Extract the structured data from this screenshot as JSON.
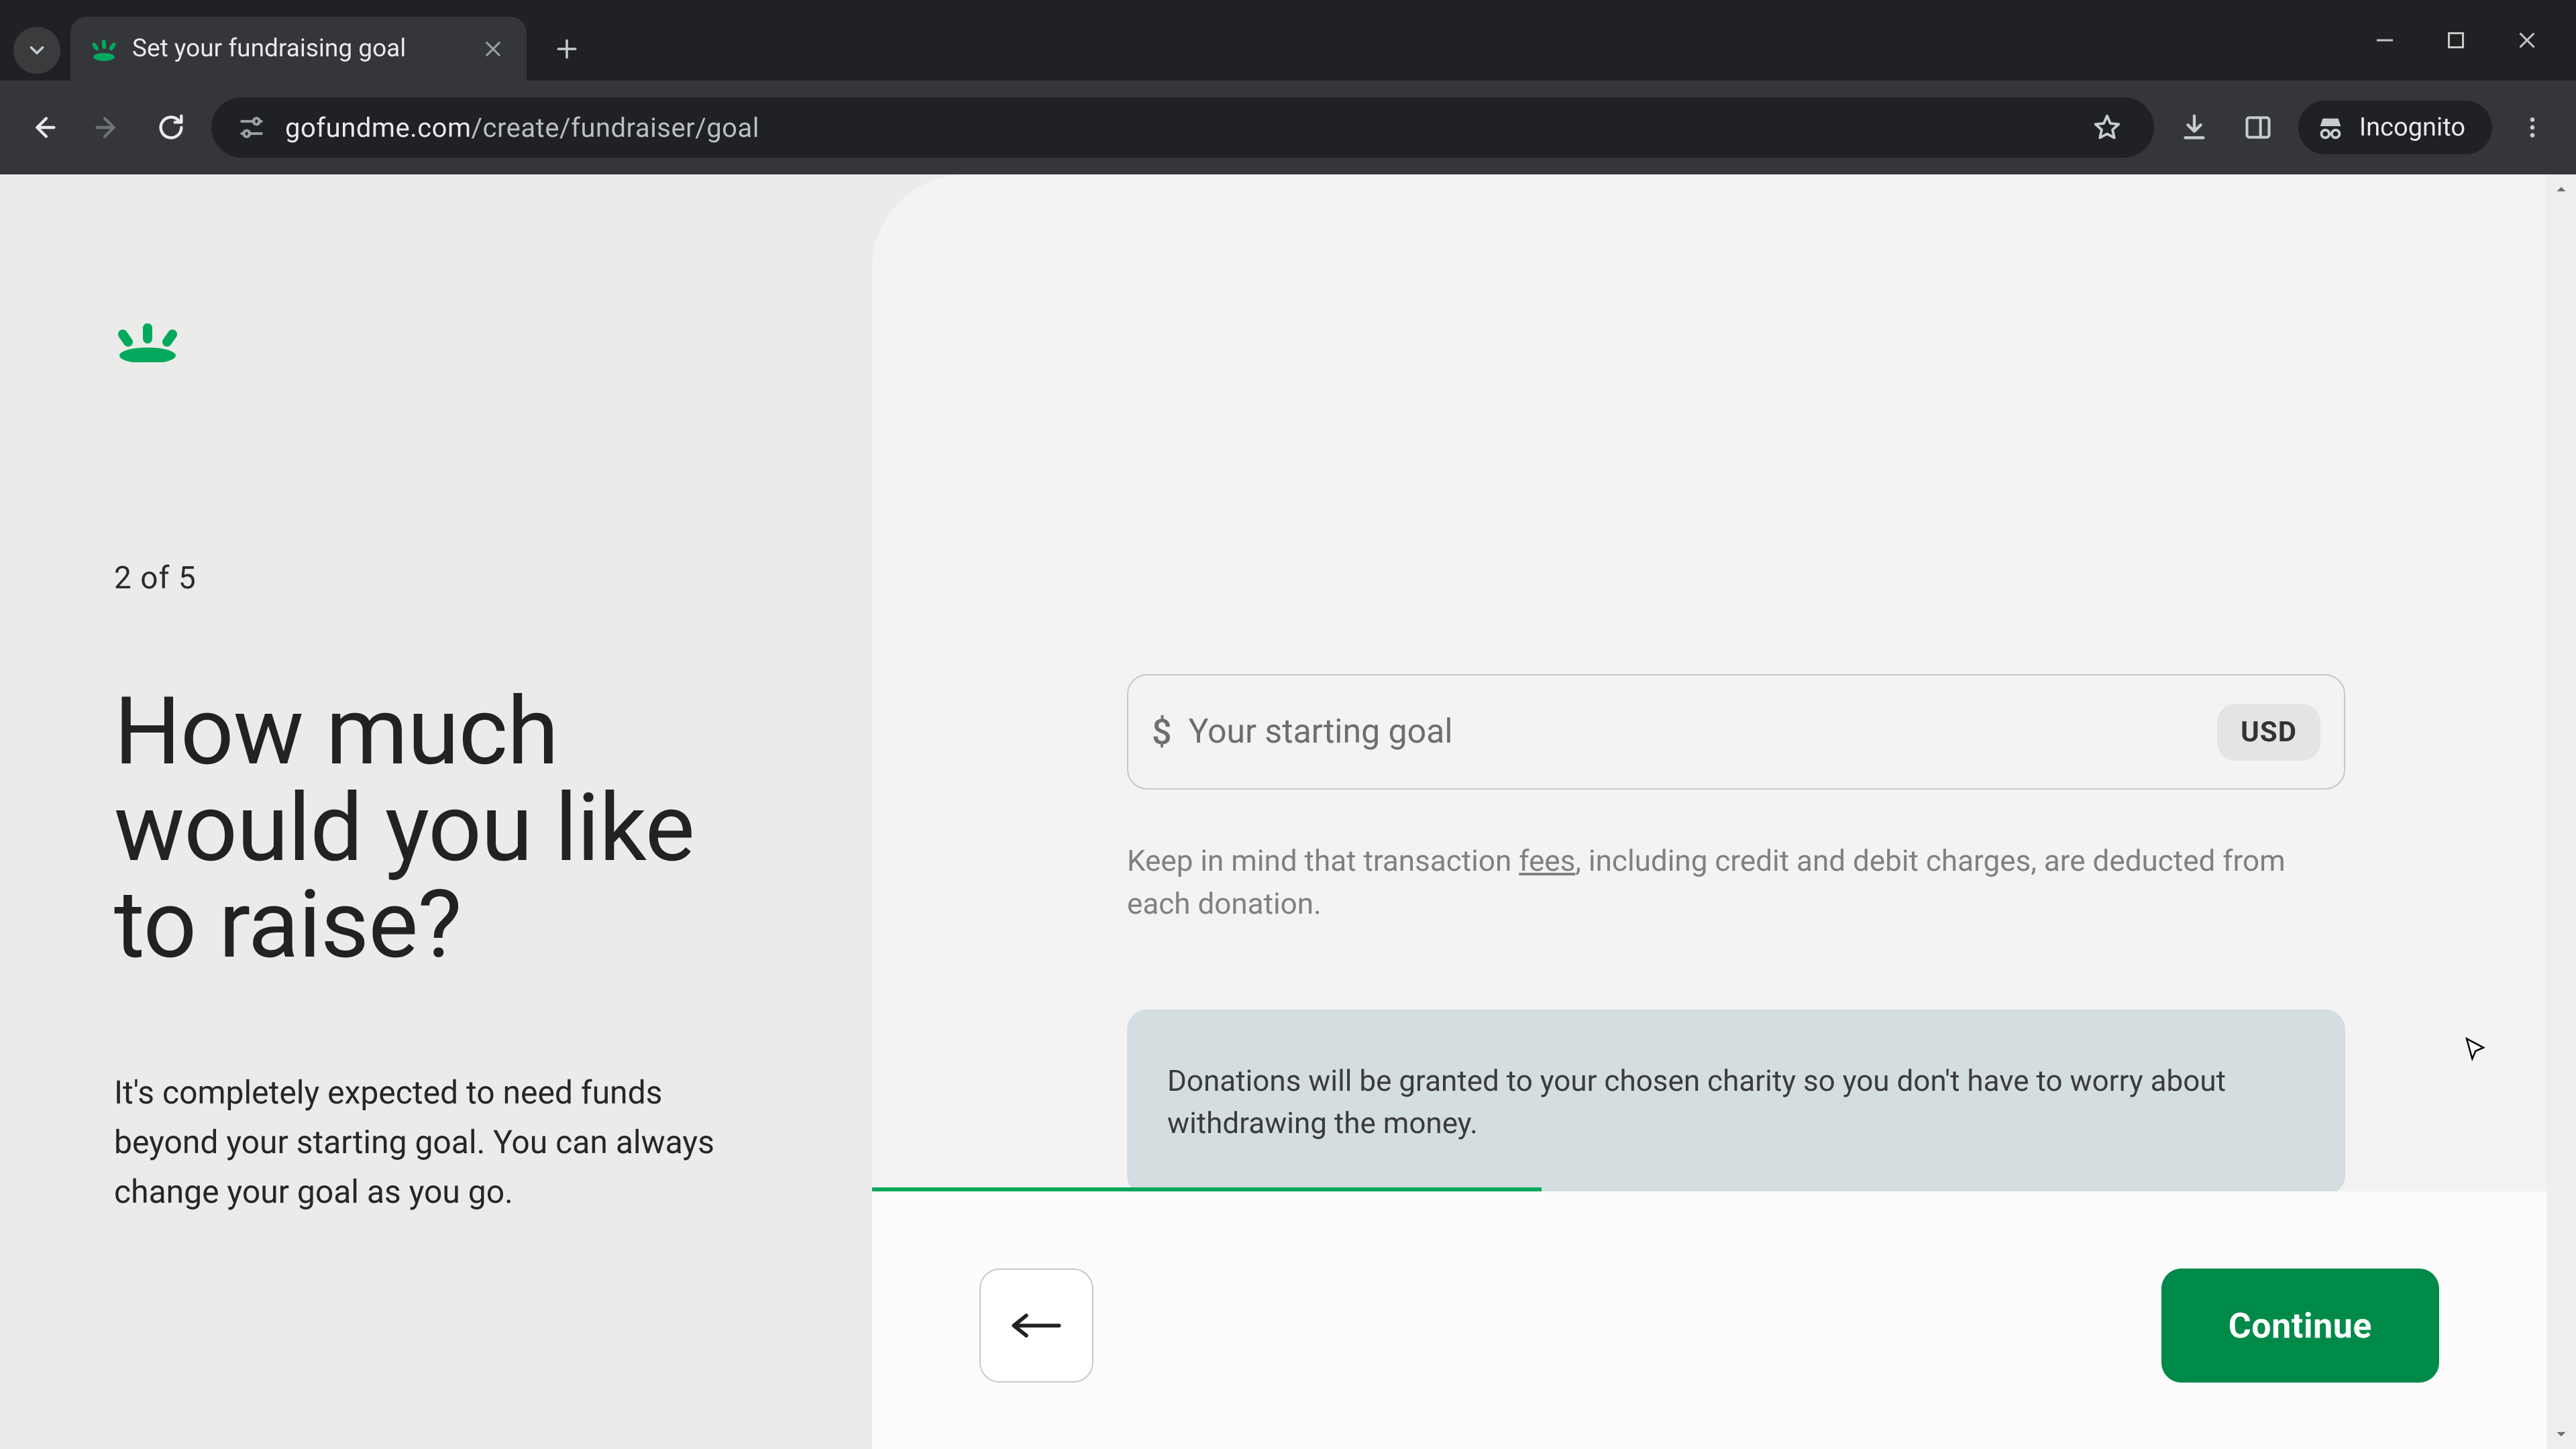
{
  "browser": {
    "tab_title": "Set your fundraising goal",
    "url_domain": "gofundme.com",
    "url_path": "/create/fundraiser/goal",
    "incognito_label": "Incognito"
  },
  "page": {
    "step_counter": "2 of 5",
    "headline": "How much would you like to raise?",
    "subtext": "It's completely expected to need funds beyond your starting goal. You can always change your goal as you go.",
    "goal": {
      "currency_symbol": "$",
      "placeholder": "Your starting goal",
      "value": "",
      "currency_code": "USD"
    },
    "fee_note_pre": "Keep in mind that transaction ",
    "fee_note_link": "fees",
    "fee_note_post": ", including credit and debit charges, are deducted from each donation.",
    "info_box": "Donations will be granted to your chosen charity so you don't have to worry about withdrawing the money.",
    "continue_label": "Continue",
    "progress_percent": 40,
    "colors": {
      "accent": "#02a95c",
      "primary_btn": "#008a4a"
    }
  }
}
